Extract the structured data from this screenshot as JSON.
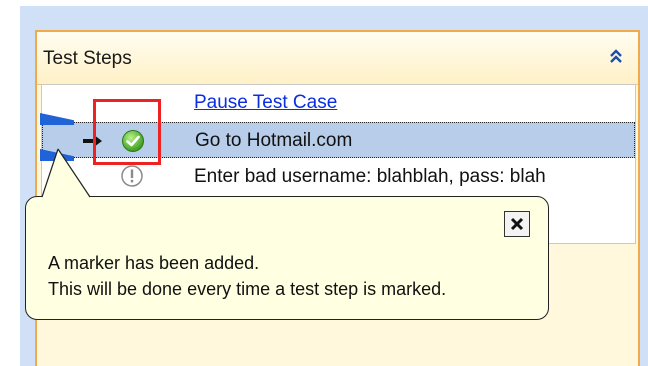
{
  "panel": {
    "title": "Test Steps"
  },
  "steps": [
    {
      "label": "Pause Test Case"
    },
    {
      "label": "Go to Hotmail.com"
    },
    {
      "label": "Enter bad username: blahblah, pass: blah"
    }
  ],
  "tooltip": {
    "line_1": "A marker has been added.",
    "line_2": "This will be done every time a test step is marked."
  },
  "colors": {
    "accent": "#f2a94a",
    "selection": "#b7cdea",
    "marker": "#1f63d6",
    "highlight": "#ee2222",
    "tooltip_bg": "#ffffe1"
  },
  "icons": [
    "collapse-double-chevron-up-icon",
    "current-step-arrow-icon",
    "passed-check-icon",
    "info-exclamation-icon",
    "close-x-icon",
    "marker-flag-icon"
  ]
}
